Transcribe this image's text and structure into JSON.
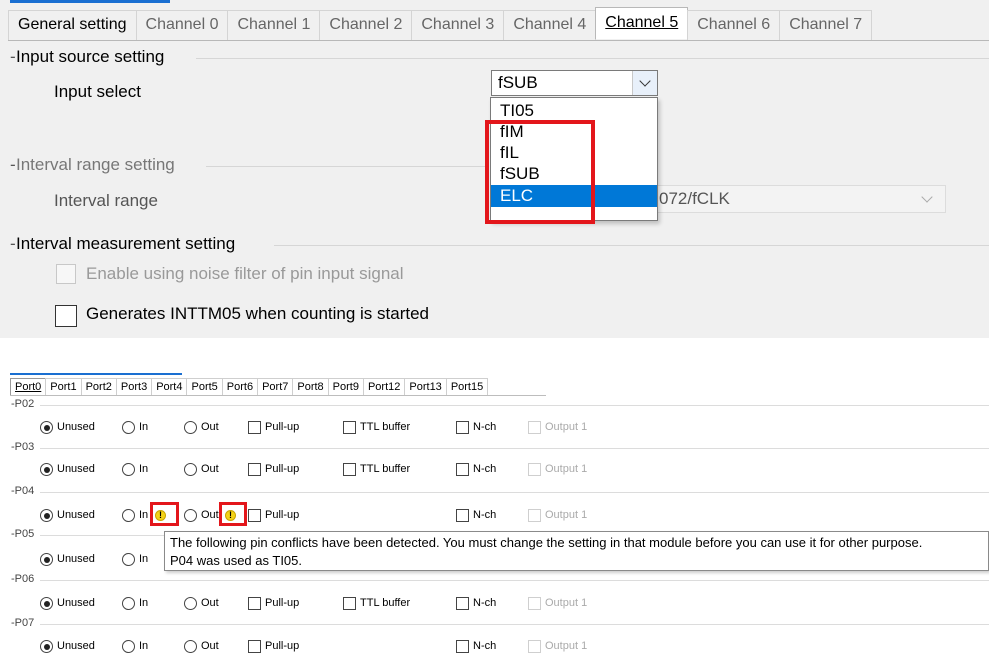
{
  "top_panel": {
    "tabs": [
      "General setting",
      "Channel 0",
      "Channel 1",
      "Channel 2",
      "Channel 3",
      "Channel 4",
      "Channel 5",
      "Channel 6",
      "Channel 7"
    ],
    "active_tab": "Channel 5",
    "input_source": {
      "section_title": "Input source setting",
      "label": "Input select",
      "selected": "fSUB",
      "options": [
        "TI05",
        "fIM",
        "fIL",
        "fSUB",
        "ELC"
      ],
      "highlighted_option": "ELC"
    },
    "interval_range": {
      "section_title": "Interval range setting",
      "label": "Interval range",
      "value_partial": "072/fCLK"
    },
    "interval_measurement": {
      "section_title": "Interval measurement setting",
      "noise_filter_label": "Enable using noise filter of pin input signal",
      "noise_filter_enabled": false,
      "inttm05_label": "Generates INTTM05 when counting is started",
      "inttm05_checked": false
    }
  },
  "bottom_panel": {
    "tabs": [
      "Port0",
      "Port1",
      "Port2",
      "Port3",
      "Port4",
      "Port5",
      "Port6",
      "Port7",
      "Port8",
      "Port9",
      "Port12",
      "Port13",
      "Port15"
    ],
    "active_tab": "Port0",
    "option_labels": {
      "unused": "Unused",
      "in": "In",
      "out": "Out",
      "pullup": "Pull-up",
      "ttl": "TTL buffer",
      "nch": "N-ch",
      "output1": "Output 1"
    },
    "ports": [
      "P02",
      "P03",
      "P04",
      "P05",
      "P06",
      "P07"
    ],
    "tooltip": {
      "line1": "The following pin conflicts have been detected. You must change the setting in that module before you can use it for other purpose.",
      "line2": "P04 was used as TI05."
    }
  },
  "colors": {
    "selection": "#0078d7",
    "highlight_box": "#e3161b",
    "warning": "#f4d319",
    "tab_accent": "#1a6fd1"
  },
  "icons": {
    "combo_arrow": "chevron-down-icon",
    "conflict": "warning-icon"
  }
}
